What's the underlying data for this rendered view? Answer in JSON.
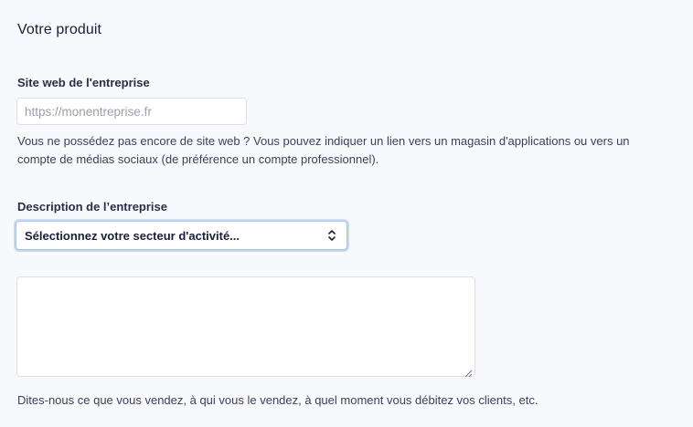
{
  "section": {
    "title": "Votre produit"
  },
  "website": {
    "label": "Site web de l'entreprise",
    "placeholder": "https://monentreprise.fr",
    "value": "",
    "help": "Vous ne possédez pas encore de site web ? Vous pouvez indiquer un lien vers un magasin d'applications ou vers un compte de médias sociaux (de préférence un compte professionnel)."
  },
  "description": {
    "label": "Description de l’entreprise",
    "select_value": "Sélectionnez votre secteur d'activité...",
    "textarea_value": "",
    "help": "Dites-nous ce que vous vendez, à qui vous le vendez, à quel moment vous débitez vos clients, etc."
  },
  "icons": {
    "select_chevrons": "chevron-up-down-icon",
    "textarea_resize": "resize-grip-icon"
  }
}
